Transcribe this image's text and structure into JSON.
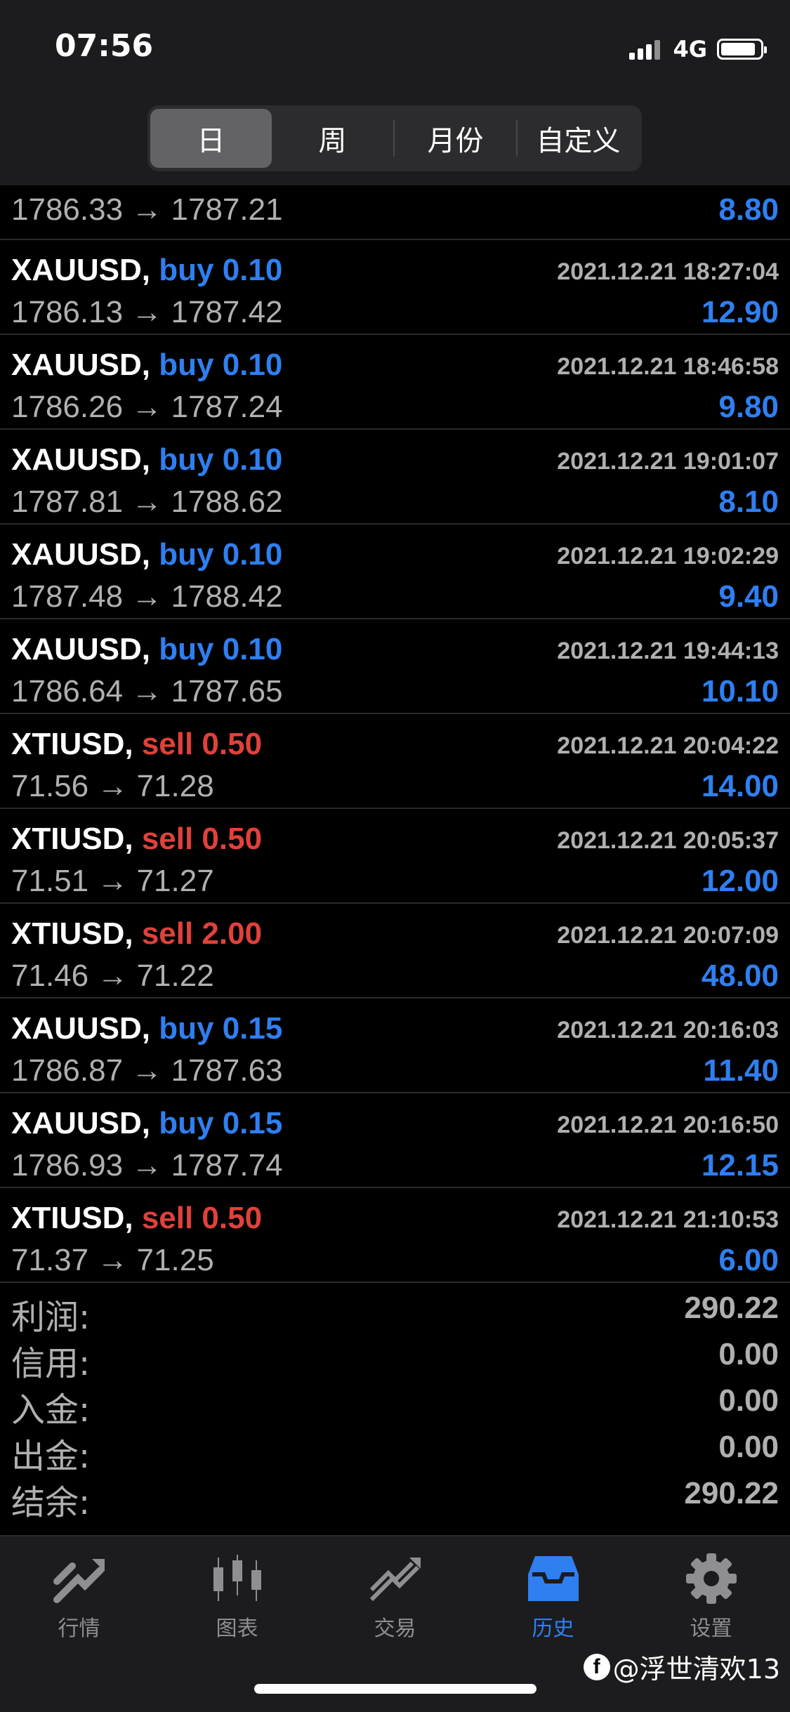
{
  "status_bar": {
    "time": "07:56",
    "network": "4G"
  },
  "period_tabs": [
    {
      "label": "日",
      "active": true
    },
    {
      "label": "周",
      "active": false
    },
    {
      "label": "月份",
      "active": false
    },
    {
      "label": "自定义",
      "active": false
    }
  ],
  "first_row": {
    "prices": "1786.33 → 1787.21",
    "profit": "8.80"
  },
  "trades": [
    {
      "symbol": "XAUUSD,",
      "side": "buy 0.10",
      "side_type": "buy",
      "datetime": "2021.12.21 18:27:04",
      "prices": "1786.13 → 1787.42",
      "profit": "12.90"
    },
    {
      "symbol": "XAUUSD,",
      "side": "buy 0.10",
      "side_type": "buy",
      "datetime": "2021.12.21 18:46:58",
      "prices": "1786.26 → 1787.24",
      "profit": "9.80"
    },
    {
      "symbol": "XAUUSD,",
      "side": "buy 0.10",
      "side_type": "buy",
      "datetime": "2021.12.21 19:01:07",
      "prices": "1787.81 → 1788.62",
      "profit": "8.10"
    },
    {
      "symbol": "XAUUSD,",
      "side": "buy 0.10",
      "side_type": "buy",
      "datetime": "2021.12.21 19:02:29",
      "prices": "1787.48 → 1788.42",
      "profit": "9.40"
    },
    {
      "symbol": "XAUUSD,",
      "side": "buy 0.10",
      "side_type": "buy",
      "datetime": "2021.12.21 19:44:13",
      "prices": "1786.64 → 1787.65",
      "profit": "10.10"
    },
    {
      "symbol": "XTIUSD,",
      "side": "sell 0.50",
      "side_type": "sell",
      "datetime": "2021.12.21 20:04:22",
      "prices": "71.56 → 71.28",
      "profit": "14.00"
    },
    {
      "symbol": "XTIUSD,",
      "side": "sell 0.50",
      "side_type": "sell",
      "datetime": "2021.12.21 20:05:37",
      "prices": "71.51 → 71.27",
      "profit": "12.00"
    },
    {
      "symbol": "XTIUSD,",
      "side": "sell 2.00",
      "side_type": "sell",
      "datetime": "2021.12.21 20:07:09",
      "prices": "71.46 → 71.22",
      "profit": "48.00"
    },
    {
      "symbol": "XAUUSD,",
      "side": "buy 0.15",
      "side_type": "buy",
      "datetime": "2021.12.21 20:16:03",
      "prices": "1786.87 → 1787.63",
      "profit": "11.40"
    },
    {
      "symbol": "XAUUSD,",
      "side": "buy 0.15",
      "side_type": "buy",
      "datetime": "2021.12.21 20:16:50",
      "prices": "1786.93 → 1787.74",
      "profit": "12.15"
    },
    {
      "symbol": "XTIUSD,",
      "side": "sell 0.50",
      "side_type": "sell",
      "datetime": "2021.12.21 21:10:53",
      "prices": "71.37 → 71.25",
      "profit": "6.00"
    }
  ],
  "summary": [
    {
      "label": "利润:",
      "value": "290.22"
    },
    {
      "label": "信用:",
      "value": "0.00"
    },
    {
      "label": "入金:",
      "value": "0.00"
    },
    {
      "label": "出金:",
      "value": "0.00"
    },
    {
      "label": "结余:",
      "value": "290.22"
    }
  ],
  "tab_bar": [
    {
      "label": "行情",
      "icon": "quotes-icon",
      "active": false
    },
    {
      "label": "图表",
      "icon": "chart-icon",
      "active": false
    },
    {
      "label": "交易",
      "icon": "trade-icon",
      "active": false
    },
    {
      "label": "历史",
      "icon": "history-icon",
      "active": true
    },
    {
      "label": "设置",
      "icon": "settings-icon",
      "active": false
    }
  ],
  "watermark": {
    "text": "@浮世清欢13"
  },
  "colors": {
    "buy": "#2f7ff0",
    "sell": "#e0413a",
    "active_tab": "#2f7ff0",
    "inactive_tab": "#8e8e93"
  }
}
